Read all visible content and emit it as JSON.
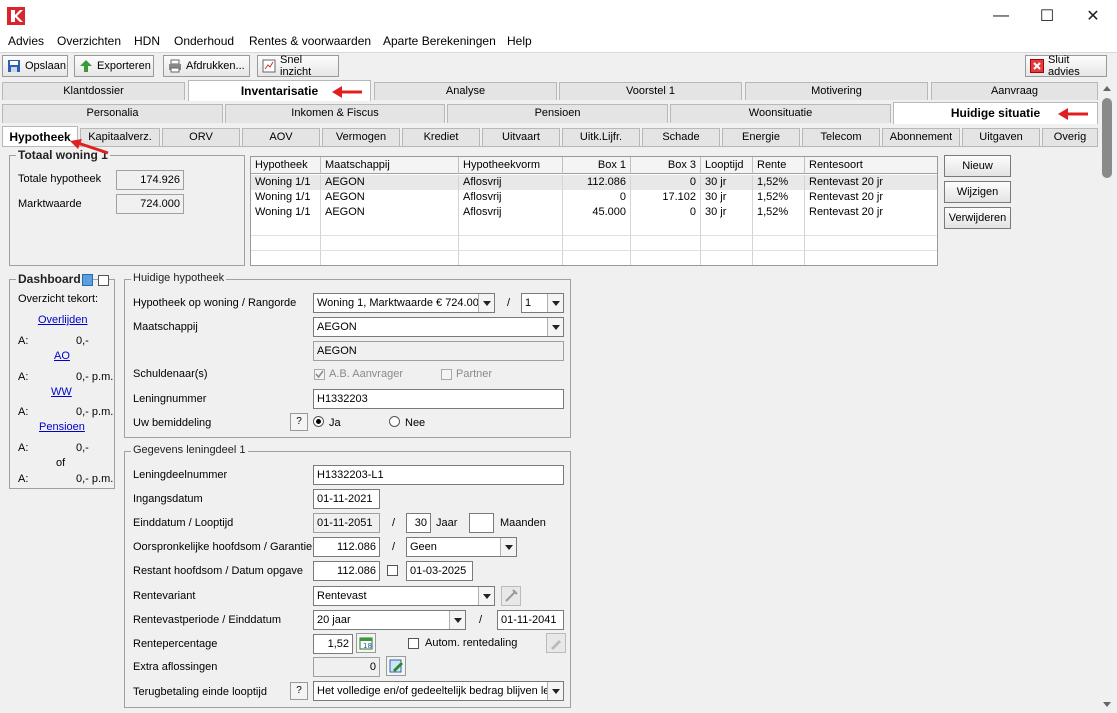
{
  "window": {
    "minimize": "—",
    "maximize": "☐",
    "close": "✕"
  },
  "menu": [
    "Advies",
    "Overzichten",
    "HDN",
    "Onderhoud",
    "Rentes & voorwaarden",
    "Aparte Berekeningen",
    "Help"
  ],
  "toolbar": {
    "save": "Opslaan",
    "export": "Exporteren",
    "print": "Afdrukken...",
    "quick": "Snel inzicht",
    "close_advice": "Sluit advies"
  },
  "tabs_main": [
    "Klantdossier",
    "Inventarisatie",
    "Analyse",
    "Voorstel 1",
    "Motivering",
    "Aanvraag"
  ],
  "tabs_sub": [
    "Personalia",
    "Inkomen & Fiscus",
    "Pensioen",
    "Woonsituatie",
    "Huidige situatie"
  ],
  "tabs_detail": [
    "Hypotheek",
    "Kapitaalverz.",
    "ORV",
    "AOV",
    "Vermogen",
    "Krediet",
    "Uitvaart",
    "Uitk.Lijfr.",
    "Schade",
    "Energie",
    "Telecom",
    "Abonnement",
    "Uitgaven",
    "Overig"
  ],
  "totaal": {
    "title": "Totaal woning 1",
    "hyp_label": "Totale hypotheek",
    "hyp_value": "174.926",
    "mw_label": "Marktwaarde",
    "mw_value": "724.000"
  },
  "grid": {
    "headers": [
      "Hypotheek",
      "Maatschappij",
      "Hypotheekvorm",
      "Box 1",
      "Box 3",
      "Looptijd",
      "Rente",
      "Rentesoort"
    ],
    "rows": [
      [
        "Woning 1/1",
        "AEGON",
        "Aflosvrij",
        "112.086",
        "0",
        "30 jr",
        "1,52%",
        "Rentevast 20 jr"
      ],
      [
        "Woning 1/1",
        "AEGON",
        "Aflosvrij",
        "0",
        "17.102",
        "30 jr",
        "1,52%",
        "Rentevast 20 jr"
      ],
      [
        "Woning 1/1",
        "AEGON",
        "Aflosvrij",
        "45.000",
        "0",
        "30 jr",
        "1,52%",
        "Rentevast 20 jr"
      ]
    ]
  },
  "buttons": {
    "new": "Nieuw",
    "edit": "Wijzigen",
    "delete": "Verwijderen"
  },
  "dashboard": {
    "title": "Dashboard",
    "subtitle": "Overzicht tekort:",
    "overlijden": "Overlijden",
    "a1": "A:",
    "v1": "0,-",
    "ao": "AO",
    "a2": "A:",
    "v2": "0,- p.m.",
    "ww": "WW",
    "a3": "A:",
    "v3": "0,- p.m.",
    "pensioen": "Pensioen",
    "a4": "A:",
    "v4": "0,-",
    "of": "of",
    "a5": "A:",
    "v5": "0,- p.m."
  },
  "huidige": {
    "title": "Huidige hypotheek",
    "woning_label": "Hypotheek op woning / Rangorde",
    "woning_value": "Woning 1, Marktwaarde € 724.000",
    "slash": "/",
    "rang_value": "1",
    "maatschappij_label": "Maatschappij",
    "maatschappij_value": "AEGON",
    "maatschappij_ro": "AEGON",
    "schuld_label": "Schuldenaar(s)",
    "schuld_aanvrager": "A.B. Aanvrager",
    "schuld_partner": "Partner",
    "lening_label": "Leningnummer",
    "lening_value": "H1332203",
    "bemid_label": "Uw bemiddeling",
    "q": "?",
    "ja": "Ja",
    "nee": "Nee"
  },
  "leningdeel": {
    "title": "Gegevens leningdeel 1",
    "nummer_label": "Leningdeelnummer",
    "nummer_value": "H1332203-L1",
    "ingang_label": "Ingangsdatum",
    "ingang_value": "01-11-2021",
    "eind_label": "Einddatum / Looptijd",
    "eind_value": "01-11-2051",
    "slash": "/",
    "jaar_value": "30",
    "jaar_label": "Jaar",
    "maand_value": "",
    "maand_label": "Maanden",
    "oorspr_label": "Oorspronkelijke hoofdsom / Garantie",
    "oorspr_value": "112.086",
    "garantie_value": "Geen",
    "restant_label": "Restant hoofdsom / Datum opgave",
    "restant_value": "112.086",
    "datum_value": "01-03-2025",
    "variant_label": "Rentevariant",
    "variant_value": "Rentevast",
    "periode_label": "Rentevastperiode / Einddatum",
    "periode_value": "20 jaar",
    "periode_eind": "01-11-2041",
    "perc_label": "Rentepercentage",
    "perc_value": "1,52",
    "autom_label": "Autom. rentedaling",
    "extra_label": "Extra aflossingen",
    "extra_value": "0",
    "terug_label": "Terugbetaling einde looptijd",
    "q": "?",
    "terug_value": "Het volledige en/of gedeeltelijk bedrag blijven lenen"
  }
}
